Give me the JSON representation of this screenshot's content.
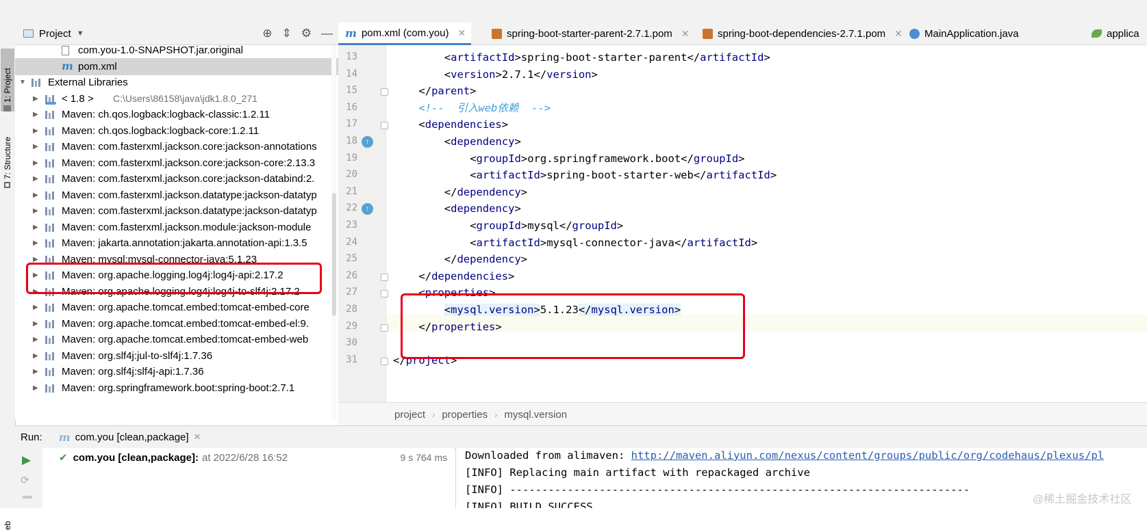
{
  "left_stripe": {
    "project_tab": "1: Project",
    "structure_tab": "7: Structure",
    "bottom_tab": "eb"
  },
  "project_panel": {
    "title": "Project",
    "tree": [
      {
        "text": "com.you-1.0-SNAPSHOT.jar.original",
        "indent": 2,
        "icon": "jar-file-icon",
        "arrow": false
      },
      {
        "text": "pom.xml",
        "indent": 2,
        "icon": "maven-icon",
        "arrow": false,
        "selected": true
      },
      {
        "text": "External Libraries",
        "indent": 0,
        "icon": "library-icon",
        "arrow": "expanded"
      },
      {
        "text": "< 1.8 >",
        "extra": "C:\\Users\\86158\\java\\jdk1.8.0_271",
        "indent": 1,
        "icon": "jdk-icon",
        "arrow": "collapsed"
      },
      {
        "text": "Maven: ch.qos.logback:logback-classic:1.2.11",
        "indent": 1,
        "icon": "library-icon",
        "arrow": "collapsed"
      },
      {
        "text": "Maven: ch.qos.logback:logback-core:1.2.11",
        "indent": 1,
        "icon": "library-icon",
        "arrow": "collapsed"
      },
      {
        "text": "Maven: com.fasterxml.jackson.core:jackson-annotations",
        "indent": 1,
        "icon": "library-icon",
        "arrow": "collapsed"
      },
      {
        "text": "Maven: com.fasterxml.jackson.core:jackson-core:2.13.3",
        "indent": 1,
        "icon": "library-icon",
        "arrow": "collapsed"
      },
      {
        "text": "Maven: com.fasterxml.jackson.core:jackson-databind:2.",
        "indent": 1,
        "icon": "library-icon",
        "arrow": "collapsed"
      },
      {
        "text": "Maven: com.fasterxml.jackson.datatype:jackson-datatyp",
        "indent": 1,
        "icon": "library-icon",
        "arrow": "collapsed"
      },
      {
        "text": "Maven: com.fasterxml.jackson.datatype:jackson-datatyp",
        "indent": 1,
        "icon": "library-icon",
        "arrow": "collapsed"
      },
      {
        "text": "Maven: com.fasterxml.jackson.module:jackson-module",
        "indent": 1,
        "icon": "library-icon",
        "arrow": "collapsed"
      },
      {
        "text": "Maven: jakarta.annotation:jakarta.annotation-api:1.3.5",
        "indent": 1,
        "icon": "library-icon",
        "arrow": "collapsed"
      },
      {
        "text": "Maven: mysql:mysql-connector-java:5.1.23",
        "indent": 1,
        "icon": "library-icon",
        "arrow": "collapsed",
        "highlighted": true
      },
      {
        "text": "Maven: org.apache.logging.log4j:log4j-api:2.17.2",
        "indent": 1,
        "icon": "library-icon",
        "arrow": "collapsed"
      },
      {
        "text": "Maven: org.apache.logging.log4j:log4j-to-slf4j:2.17.2",
        "indent": 1,
        "icon": "library-icon",
        "arrow": "collapsed"
      },
      {
        "text": "Maven: org.apache.tomcat.embed:tomcat-embed-core",
        "indent": 1,
        "icon": "library-icon",
        "arrow": "collapsed"
      },
      {
        "text": "Maven: org.apache.tomcat.embed:tomcat-embed-el:9.",
        "indent": 1,
        "icon": "library-icon",
        "arrow": "collapsed"
      },
      {
        "text": "Maven: org.apache.tomcat.embed:tomcat-embed-web",
        "indent": 1,
        "icon": "library-icon",
        "arrow": "collapsed"
      },
      {
        "text": "Maven: org.slf4j:jul-to-slf4j:1.7.36",
        "indent": 1,
        "icon": "library-icon",
        "arrow": "collapsed"
      },
      {
        "text": "Maven: org.slf4j:slf4j-api:1.7.36",
        "indent": 1,
        "icon": "library-icon",
        "arrow": "collapsed"
      },
      {
        "text": "Maven: org.springframework.boot:spring-boot:2.7.1",
        "indent": 1,
        "icon": "library-icon",
        "arrow": "collapsed"
      }
    ]
  },
  "editor_tabs": [
    {
      "label": "pom.xml (com.you)",
      "icon": "maven-icon",
      "active": true,
      "closable": true
    },
    {
      "label": "spring-boot-starter-parent-2.7.1.pom",
      "icon": "pom-file-icon",
      "active": false,
      "closable": true
    },
    {
      "label": "spring-boot-dependencies-2.7.1.pom",
      "icon": "pom-file-icon",
      "active": false,
      "closable": true
    },
    {
      "label": "MainApplication.java",
      "icon": "java-class-icon",
      "active": false,
      "closable": false
    },
    {
      "label": "applica",
      "icon": "spring-leaf-icon",
      "active": false,
      "closable": false
    }
  ],
  "code_lines": [
    {
      "num": "13",
      "indent": 8,
      "tokens": [
        [
          "tg",
          "<"
        ],
        [
          "tag",
          "artifactId"
        ],
        [
          "tg",
          ">"
        ],
        [
          "text",
          "spring-boot-starter-parent"
        ],
        [
          "tg",
          "</"
        ],
        [
          "tag",
          "artifactId"
        ],
        [
          "tg",
          ">"
        ]
      ]
    },
    {
      "num": "14",
      "indent": 8,
      "tokens": [
        [
          "tg",
          "<"
        ],
        [
          "tag",
          "version"
        ],
        [
          "tg",
          ">"
        ],
        [
          "text",
          "2.7.1"
        ],
        [
          "tg",
          "</"
        ],
        [
          "tag",
          "version"
        ],
        [
          "tg",
          ">"
        ]
      ]
    },
    {
      "num": "15",
      "indent": 4,
      "tokens": [
        [
          "tg",
          "</"
        ],
        [
          "tag",
          "parent"
        ],
        [
          "tg",
          ">"
        ]
      ]
    },
    {
      "num": "16",
      "indent": 4,
      "tokens": [
        [
          "cm",
          "<!--  引入web依赖  -->"
        ]
      ]
    },
    {
      "num": "17",
      "indent": 4,
      "tokens": [
        [
          "tg",
          "<"
        ],
        [
          "tag",
          "dependencies"
        ],
        [
          "tg",
          ">"
        ]
      ]
    },
    {
      "num": "18",
      "indent": 8,
      "tokens": [
        [
          "tg",
          "<"
        ],
        [
          "tag",
          "dependency"
        ],
        [
          "tg",
          ">"
        ]
      ]
    },
    {
      "num": "19",
      "indent": 12,
      "tokens": [
        [
          "tg",
          "<"
        ],
        [
          "tag",
          "groupId"
        ],
        [
          "tg",
          ">"
        ],
        [
          "text",
          "org.springframework.boot"
        ],
        [
          "tg",
          "</"
        ],
        [
          "tag",
          "groupId"
        ],
        [
          "tg",
          ">"
        ]
      ]
    },
    {
      "num": "20",
      "indent": 12,
      "tokens": [
        [
          "tg",
          "<"
        ],
        [
          "tag",
          "artifactId"
        ],
        [
          "tg",
          ">"
        ],
        [
          "text",
          "spring-boot-starter-web"
        ],
        [
          "tg",
          "</"
        ],
        [
          "tag",
          "artifactId"
        ],
        [
          "tg",
          ">"
        ]
      ]
    },
    {
      "num": "21",
      "indent": 8,
      "tokens": [
        [
          "tg",
          "</"
        ],
        [
          "tag",
          "dependency"
        ],
        [
          "tg",
          ">"
        ]
      ]
    },
    {
      "num": "22",
      "indent": 8,
      "tokens": [
        [
          "tg",
          "<"
        ],
        [
          "tag",
          "dependency"
        ],
        [
          "tg",
          ">"
        ]
      ]
    },
    {
      "num": "23",
      "indent": 12,
      "tokens": [
        [
          "tg",
          "<"
        ],
        [
          "tag",
          "groupId"
        ],
        [
          "tg",
          ">"
        ],
        [
          "text",
          "mysql"
        ],
        [
          "tg",
          "</"
        ],
        [
          "tag",
          "groupId"
        ],
        [
          "tg",
          ">"
        ]
      ]
    },
    {
      "num": "24",
      "indent": 12,
      "tokens": [
        [
          "tg",
          "<"
        ],
        [
          "tag",
          "artifactId"
        ],
        [
          "tg",
          ">"
        ],
        [
          "text",
          "mysql-connector-java"
        ],
        [
          "tg",
          "</"
        ],
        [
          "tag",
          "artifactId"
        ],
        [
          "tg",
          ">"
        ]
      ]
    },
    {
      "num": "25",
      "indent": 8,
      "tokens": [
        [
          "tg",
          "</"
        ],
        [
          "tag",
          "dependency"
        ],
        [
          "tg",
          ">"
        ]
      ]
    },
    {
      "num": "26",
      "indent": 4,
      "tokens": [
        [
          "tg",
          "</"
        ],
        [
          "tag",
          "dependencies"
        ],
        [
          "tg",
          ">"
        ]
      ]
    },
    {
      "num": "27",
      "indent": 4,
      "tokens": [
        [
          "tg",
          "<"
        ],
        [
          "tag",
          "properties"
        ],
        [
          "tg",
          ">"
        ]
      ]
    },
    {
      "num": "28",
      "indent": 8,
      "tokens": [
        [
          "hl",
          "<"
        ],
        [
          "hltag",
          "mysql.version"
        ],
        [
          "hl",
          ">"
        ],
        [
          "text",
          "5.1.23"
        ],
        [
          "hl",
          "</"
        ],
        [
          "hltag",
          "mysql.version"
        ],
        [
          "hl",
          ">"
        ]
      ]
    },
    {
      "num": "29",
      "indent": 4,
      "tokens": [
        [
          "tg",
          "</"
        ],
        [
          "tag",
          "properties"
        ],
        [
          "tg",
          ">"
        ]
      ]
    },
    {
      "num": "30",
      "indent": 0,
      "tokens": []
    },
    {
      "num": "31",
      "indent": 0,
      "tokens": [
        [
          "tg",
          "</"
        ],
        [
          "tag",
          "project"
        ],
        [
          "tg",
          ">"
        ]
      ]
    }
  ],
  "breadcrumb": [
    "project",
    "properties",
    "mysql.version"
  ],
  "run_panel": {
    "label": "Run:",
    "tab_label": "com.you [clean,package]",
    "task_name": "com.you [clean,package]:",
    "task_time": "at 2022/6/28 16:52",
    "duration": "9 s 764 ms",
    "console_lines": [
      {
        "prefix": "Downloaded from alimaven: ",
        "link": "http://maven.aliyun.com/nexus/content/groups/public/org/codehaus/plexus/pl"
      },
      {
        "prefix": "[INFO] Replacing main artifact with repackaged archive",
        "link": ""
      },
      {
        "prefix": "[INFO] ------------------------------------------------------------------------",
        "link": ""
      },
      {
        "prefix": "[INFO] BUILD SUCCESS",
        "link": ""
      }
    ]
  },
  "watermark": "@稀土掘金技术社区",
  "colors": {
    "tag": "#000080",
    "comment": "#43a0d8",
    "highlight_box": "#e8001c",
    "link": "#2a5db0",
    "active_tab_accent": "#4083c9"
  }
}
